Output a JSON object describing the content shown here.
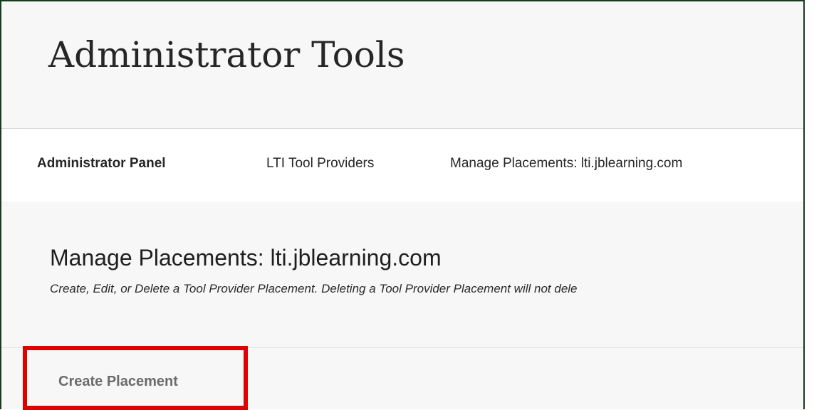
{
  "header": {
    "title": "Administrator Tools"
  },
  "breadcrumb": {
    "items": [
      {
        "label": "Administrator Panel"
      },
      {
        "label": "LTI Tool Providers"
      },
      {
        "label": "Manage Placements: lti.jblearning.com"
      }
    ]
  },
  "main": {
    "title": "Manage Placements: lti.jblearning.com",
    "description": "Create, Edit, or Delete a Tool Provider Placement. Deleting a Tool Provider Placement will not dele"
  },
  "actions": {
    "create_label": "Create Placement"
  },
  "colors": {
    "highlight": "#e00000",
    "frame_border": "#1b3a1d",
    "page_background": "#f7f7f7"
  }
}
